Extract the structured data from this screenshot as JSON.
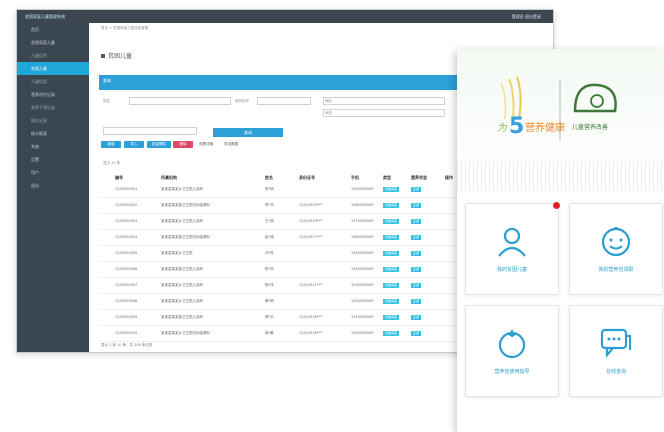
{
  "desktop": {
    "app_logo": "贫困家庭儿童管理系统",
    "user": "管理员 退出登录",
    "breadcrumb": "首页  >  贫困家庭儿童信息管理",
    "page_title": "贫困儿童",
    "panel_title": "查询",
    "sidebar": [
      {
        "label": "首页",
        "type": "item"
      },
      {
        "label": "贫困家庭儿童",
        "type": "item"
      },
      {
        "label": "儿童信息",
        "type": "sub"
      },
      {
        "label": "贫困儿童",
        "type": "active"
      },
      {
        "label": "儿童档案",
        "type": "sub"
      },
      {
        "label": "营养评估记录",
        "type": "item"
      },
      {
        "label": "营养干预记录",
        "type": "sub"
      },
      {
        "label": "随访记录",
        "type": "sub"
      },
      {
        "label": "统计报表",
        "type": "item"
      },
      {
        "label": "系统",
        "type": "item"
      },
      {
        "label": "设置",
        "type": "item"
      },
      {
        "label": "用户",
        "type": "item"
      },
      {
        "label": "退出",
        "type": "item"
      }
    ],
    "filters": {
      "f1": "姓名",
      "f2": "身份证号",
      "f3": "地区",
      "f4": "状态"
    },
    "query_button": "查询",
    "toolbar": [
      {
        "label": "新增",
        "color": "#2ea0d8"
      },
      {
        "label": "导入",
        "color": "#2ea0d8"
      },
      {
        "label": "批量删除",
        "color": "#2ea0d8"
      },
      {
        "label": "删除",
        "color": "#e0486b"
      },
      {
        "label": "查看详情",
        "color": ""
      },
      {
        "label": "导出数据",
        "color": ""
      }
    ],
    "page_size_label": "显示 10 条",
    "headers": [
      "编号",
      "所属机构",
      "姓名",
      "身份证号",
      "手机",
      "类型",
      "营养状态",
      "操作"
    ],
    "rows": [
      {
        "id": "1100000001",
        "org": "某某县某某乡卫生院儿保科",
        "name": "张*明",
        "idc": "",
        "phone": "1390000000",
        "type": "贫困家庭",
        "status": "正常"
      },
      {
        "id": "1100000002",
        "org": "某某县某某镇卫生院妇幼保健科",
        "name": "李*华",
        "idc": "11010520***",
        "phone": "1380000000",
        "type": "贫困家庭",
        "status": "正常"
      },
      {
        "id": "1100000003",
        "org": "某某县某某乡卫生院儿保科",
        "name": "王*丽",
        "idc": "11010519***",
        "phone": "1370000000",
        "type": "贫困家庭",
        "status": "正常"
      },
      {
        "id": "1100000004",
        "org": "某某县某某镇卫生院妇幼保健科",
        "name": "赵*强",
        "idc": "11010517***",
        "phone": "1360000000",
        "type": "贫困家庭",
        "status": "正常"
      },
      {
        "id": "1100000005",
        "org": "某某县某某乡卫生院",
        "name": "刘*芳",
        "idc": "",
        "phone": "1350000000",
        "type": "贫困家庭",
        "status": "正常"
      },
      {
        "id": "1100000006",
        "org": "某某县某某镇卫生院儿保科",
        "name": "陈*杰",
        "idc": "",
        "phone": "1340000000",
        "type": "贫困家庭",
        "status": "正常"
      },
      {
        "id": "1100000007",
        "org": "某某县某某乡卫生院儿保科",
        "name": "杨*洋",
        "idc": "11010521***",
        "phone": "1330000000",
        "type": "贫困家庭",
        "status": "正常"
      },
      {
        "id": "1100000008",
        "org": "某某县某某乡卫生院儿保科",
        "name": "黄*婷",
        "idc": "",
        "phone": "1320000000",
        "type": "贫困家庭",
        "status": "正常"
      },
      {
        "id": "1100000009",
        "org": "某某县某某镇卫生院儿保科",
        "name": "周*宇",
        "idc": "11010516***",
        "phone": "1310000000",
        "type": "贫困家庭",
        "status": "正常"
      },
      {
        "id": "1100000010",
        "org": "某某县某某乡卫生院妇幼保健科",
        "name": "吴*敏",
        "idc": "11010518***",
        "phone": "1300000000",
        "type": "贫困家庭",
        "status": "正常"
      }
    ],
    "pager": "显示 1 到 10 条，共 100 条记录"
  },
  "mobile": {
    "logo_left_big": "5",
    "logo_left_text": "营养健康",
    "logo_right_text": "儿童营养改善",
    "cards": [
      {
        "label": "我的贫困儿童",
        "icon": "person-icon",
        "badge": true
      },
      {
        "label": "我的营养包领取",
        "icon": "baby-face-icon",
        "badge": false
      },
      {
        "label": "营养包使用指导",
        "icon": "tomato-icon",
        "badge": false
      },
      {
        "label": "在线咨询",
        "icon": "chat-icon",
        "badge": false
      }
    ],
    "accent": "#2c9fd0",
    "badge_color": "#e02020"
  }
}
